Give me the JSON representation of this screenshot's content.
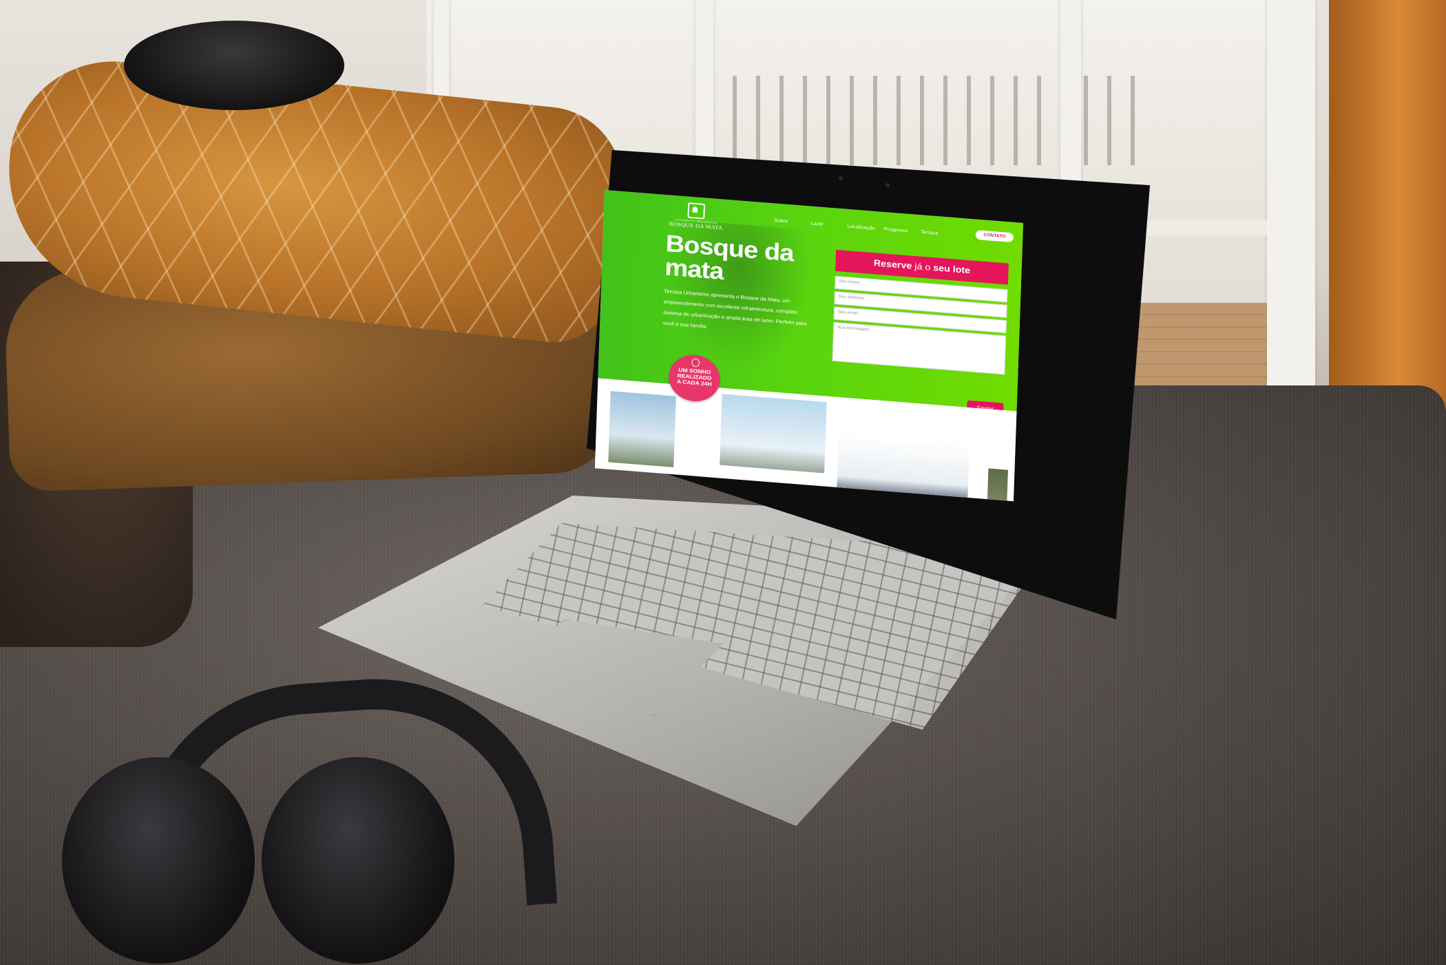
{
  "scene": {
    "description_colors": {
      "hero_green": "#58d40f",
      "accent_pink": "#e5155b",
      "badge_pink": "#e8366a"
    }
  },
  "site": {
    "logo": {
      "subtitle": "LOTEAMENTO RESIDENCIAL",
      "name": "BOSQUE DA MATA"
    },
    "nav": {
      "items": [
        "Sobre",
        "Lazer",
        "Localização",
        "Progresso",
        "Terraza"
      ],
      "contact_button": "CONTATO"
    },
    "hero": {
      "title_line1": "Bosque da",
      "title_line2": "mata",
      "description": "Terraza Urbanismo apresenta o Bosque da Mata, um empreendimento com excelente infraestrutura, completo sistema de urbanização e ampla área de lazer. Perfeito para você e sua família."
    },
    "badge": {
      "line1": "UM SONHO",
      "line2": "REALIZADO",
      "line3": "A CADA 24H",
      "icon": "apple-icon"
    },
    "form": {
      "heading_part1": "Reserve",
      "heading_part2": "já o",
      "heading_part3": "seu lote",
      "name_placeholder": "Seu nome",
      "phone_placeholder": "Seu telefone",
      "email_placeholder": "Seu email",
      "message_placeholder": "Sua mensagem",
      "submit_label": "Enviar"
    }
  }
}
